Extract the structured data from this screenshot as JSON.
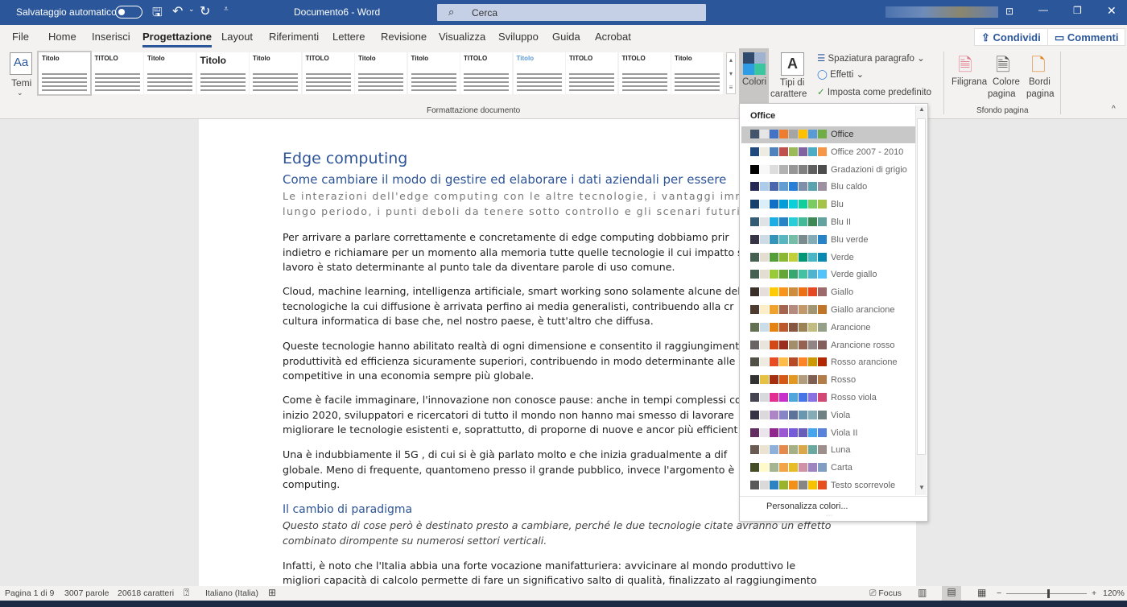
{
  "titlebar": {
    "autosave": "Salvataggio automatico",
    "doc_title": "Documento6 - Word",
    "search_placeholder": "Cerca"
  },
  "tabs": [
    "File",
    "Home",
    "Inserisci",
    "Progettazione",
    "Layout",
    "Riferimenti",
    "Lettere",
    "Revisione",
    "Visualizza",
    "Sviluppo",
    "Guida",
    "Acrobat"
  ],
  "share": "Condividi",
  "comments": "Commenti",
  "ribbon": {
    "temi": "Temi",
    "gallery": [
      "Titolo",
      "TITOLO",
      "Titolo",
      "Titolo",
      "Titolo",
      "TITOLO",
      "Titolo",
      "Titolo",
      "TITOLO",
      "Titolo",
      "TITOLO",
      "TITOLO",
      "Titolo"
    ],
    "group_formatting": "Formattazione documento",
    "colori": "Colori",
    "tipi1": "Tipi di",
    "tipi2": "carattere",
    "spaziatura": "Spaziatura paragrafo",
    "effetti": "Effetti",
    "predefinito": "Imposta come predefinito",
    "filigrana": "Filigrana",
    "colore1": "Colore",
    "colore2": "pagina",
    "bordi1": "Bordi",
    "bordi2": "pagina",
    "group_sfondo": "Sfondo pagina"
  },
  "document": {
    "title": "Edge computing",
    "subtitle": "Come cambiare il modo di gestire ed elaborare i dati aziendali per essere",
    "intro": [
      "Le interazioni dell'edge computing con le altre tecnologie, i vantaggi immed",
      "lungo periodo, i punti deboli da tenere sotto controllo e gli scenari futuri"
    ],
    "p1": [
      "Per arrivare a parlare correttamente e concretamente di edge computing dobbiamo prir",
      "indietro e richiamare per un momento alla memoria tutte quelle tecnologie il cui impatto s",
      "lavoro è stato determinante al punto tale da diventare parole di uso comune."
    ],
    "p2": [
      "Cloud, machine learning, intelligenza artificiale, smart working sono solamente alcune del",
      "tecnologiche la cui diffusione è arrivata perfino ai media generalisti, contribuendo alla cr",
      "cultura informatica di base che, nel nostro paese, è tutt'altro che diffusa."
    ],
    "p3": [
      "Queste tecnologie hanno abilitato realtà di ogni dimensione e consentito il raggiungiment",
      "produttività ed efficienza sicuramente superiori, contribuendo in modo determinante alle",
      "competitive in una economia sempre più globale."
    ],
    "p4": [
      "Come è facile immaginare, l'innovazione non conosce pause: anche in tempi complessi con",
      "inizio 2020, sviluppatori e ricercatori di tutto il mondo non hanno mai smesso di lavorare",
      "migliorare le tecnologie esistenti e, soprattutto, di proporne di nuove e ancor più efficient"
    ],
    "p5": [
      "Una è indubbiamente il 5G , di cui si è già parlato molto e che inizia gradualmente a dif",
      "globale. Meno di frequente, quantomeno presso il grande pubblico, invece l'argomento è",
      "computing."
    ],
    "heading2": "Il cambio di paradigma",
    "italic": [
      "Questo stato di cose però è destinato presto a cambiare, perché le due tecnologie citate avranno un effetto",
      "combinato dirompente su numerosi settori verticali."
    ],
    "p6": [
      "Infatti, è noto che l'Italia abbia una forte vocazione manifatturiera: avvicinare al mondo produttivo le",
      "migliori capacità di calcolo permette di fare un significativo salto di qualità, finalizzato al raggiungimento"
    ]
  },
  "colors_menu": {
    "header": "Office",
    "footer": "Personalizza colori...",
    "selected": "Office",
    "items": [
      {
        "name": "Office",
        "colors": [
          "#44546a",
          "#e7e6e6",
          "#4472c4",
          "#ed7d31",
          "#a5a5a5",
          "#ffc000",
          "#5b9bd5",
          "#70ad47"
        ]
      },
      {
        "name": "Office 2007 - 2010",
        "colors": [
          "#1f497d",
          "#eeece1",
          "#4f81bd",
          "#c0504d",
          "#9bbb59",
          "#8064a2",
          "#4bacc6",
          "#f79646"
        ]
      },
      {
        "name": "Gradazioni di grigio",
        "colors": [
          "#000000",
          "#f8f8f8",
          "#dddddd",
          "#b2b2b2",
          "#969696",
          "#808080",
          "#5f5f5f",
          "#4d4d4d"
        ]
      },
      {
        "name": "Blu caldo",
        "colors": [
          "#242852",
          "#acccea",
          "#4a66ac",
          "#629dd1",
          "#297fd5",
          "#7f8fa9",
          "#5aa2ae",
          "#9d90a0"
        ]
      },
      {
        "name": "Blu",
        "colors": [
          "#17406d",
          "#dbeff9",
          "#0f6fc6",
          "#009dd9",
          "#0bd0d9",
          "#10cf9b",
          "#7cca62",
          "#a5c249"
        ]
      },
      {
        "name": "Blu II",
        "colors": [
          "#335b74",
          "#dfe3e5",
          "#1cade4",
          "#2683c6",
          "#27ced7",
          "#42ba97",
          "#3e8853",
          "#62a39f"
        ]
      },
      {
        "name": "Blu verde",
        "colors": [
          "#373545",
          "#cedbe6",
          "#3494ba",
          "#58b6c0",
          "#75bda7",
          "#7a8c8e",
          "#84acb6",
          "#2683c6"
        ]
      },
      {
        "name": "Verde",
        "colors": [
          "#455f51",
          "#e3ded1",
          "#549e39",
          "#8ab833",
          "#c0cf3a",
          "#029676",
          "#4ab5c4",
          "#0989b1"
        ]
      },
      {
        "name": "Verde giallo",
        "colors": [
          "#455f51",
          "#e3ded1",
          "#99cb38",
          "#63a537",
          "#37a76f",
          "#44c1a3",
          "#4eb3cf",
          "#51c3f9"
        ]
      },
      {
        "name": "Giallo",
        "colors": [
          "#39302a",
          "#e5dedb",
          "#ffca08",
          "#f8931d",
          "#ce8d3e",
          "#ec7016",
          "#e64823",
          "#9c6a6a"
        ]
      },
      {
        "name": "Giallo arancione",
        "colors": [
          "#4e3b30",
          "#fbeec9",
          "#f0a22e",
          "#a5644e",
          "#b58b80",
          "#c3986d",
          "#a19574",
          "#c17529"
        ]
      },
      {
        "name": "Arancione",
        "colors": [
          "#637052",
          "#ccddea",
          "#e48312",
          "#bd582c",
          "#865640",
          "#9b8357",
          "#c2bc80",
          "#94a088"
        ]
      },
      {
        "name": "Arancione rosso",
        "colors": [
          "#696464",
          "#e9e5dc",
          "#d34817",
          "#9b2d1f",
          "#a28e6a",
          "#956251",
          "#918485",
          "#855d5d"
        ]
      },
      {
        "name": "Rosso arancione",
        "colors": [
          "#505046",
          "#eeece1",
          "#e84c22",
          "#ffbd47",
          "#b64926",
          "#ff8427",
          "#cc9900",
          "#b22600"
        ]
      },
      {
        "name": "Rosso",
        "colors": [
          "#323232",
          "#e5c243",
          "#a5300f",
          "#d55816",
          "#e19825",
          "#b19c7d",
          "#7f5f52",
          "#b27d49"
        ]
      },
      {
        "name": "Rosso viola",
        "colors": [
          "#454551",
          "#d8d9dc",
          "#e32d91",
          "#c830cc",
          "#4ea6dc",
          "#4775e7",
          "#8971e1",
          "#d54773"
        ]
      },
      {
        "name": "Viola",
        "colors": [
          "#373545",
          "#dcd8dc",
          "#ad84c6",
          "#8784c7",
          "#5d739a",
          "#6997af",
          "#84acb6",
          "#6f8183"
        ]
      },
      {
        "name": "Viola II",
        "colors": [
          "#632e62",
          "#eae5eb",
          "#92278f",
          "#9b57d3",
          "#755dd9",
          "#665eb8",
          "#45a5ed",
          "#5982db"
        ]
      },
      {
        "name": "Luna",
        "colors": [
          "#6a5b52",
          "#ebe3d2",
          "#8fb0d8",
          "#e38a4c",
          "#a6b086",
          "#d9a84a",
          "#6ba8a0",
          "#9c8f8c"
        ]
      },
      {
        "name": "Carta",
        "colors": [
          "#444d26",
          "#fefac9",
          "#a5b592",
          "#f3a447",
          "#e7bc29",
          "#d092a7",
          "#9c85c0",
          "#809ec2"
        ]
      },
      {
        "name": "Testo scorrevole",
        "colors": [
          "#595959",
          "#dadada",
          "#2e83c3",
          "#99b32c",
          "#f39018",
          "#868686",
          "#f7c200",
          "#e5501e"
        ]
      }
    ]
  },
  "status": {
    "page": "Pagina 1 di 9",
    "words": "3007 parole",
    "chars": "20618 caratteri",
    "language": "Italiano (Italia)",
    "focus": "Focus",
    "zoom": "120%",
    "zoom_percent": 120
  }
}
